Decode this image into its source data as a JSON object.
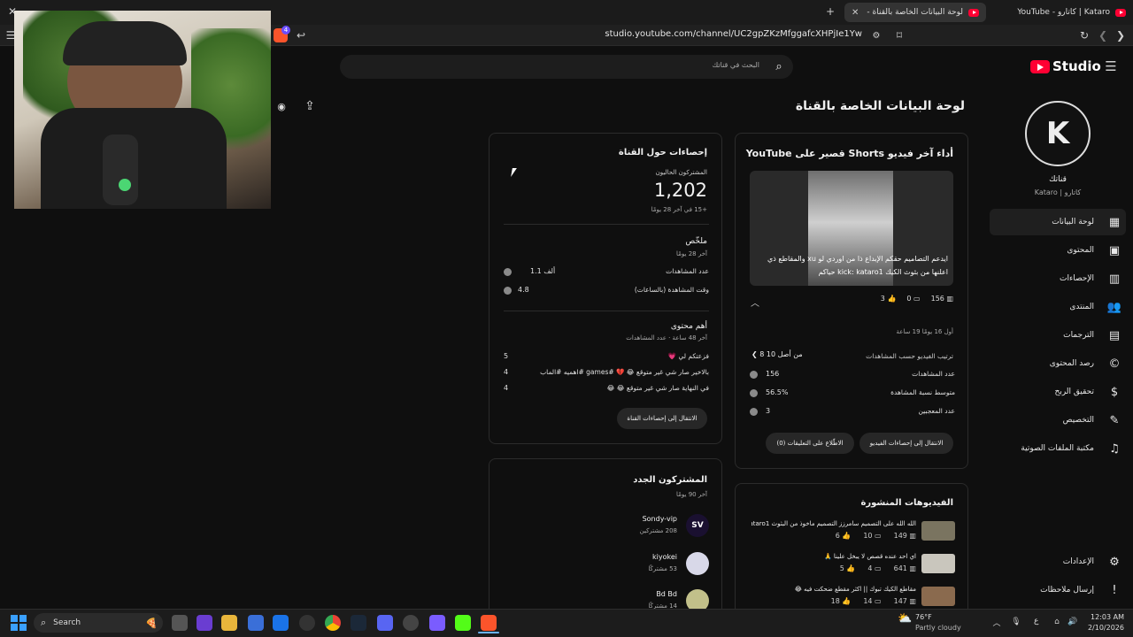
{
  "browser": {
    "tabs": [
      {
        "label": "Kataro | كاتارو - YouTube"
      },
      {
        "label": "لوحة البيانات الخاصة بالقناة - YouTube Studio"
      }
    ],
    "url": "studio.youtube.com/channel/UC2gpZKzMfggafcXHPjIe1Yw",
    "shields_count": "4"
  },
  "studio": {
    "logo_text": "Studio",
    "search_placeholder": "البحث في قناتك",
    "page_title": "لوحة البيانات الخاصة بالقناة",
    "channel": {
      "title": "قناتك",
      "name": "Kataro | كاتارو"
    }
  },
  "sidebar": {
    "items": [
      {
        "label": "لوحة البيانات",
        "icon": "dashboard-icon"
      },
      {
        "label": "المحتوى",
        "icon": "content-icon"
      },
      {
        "label": "الإحصاءات",
        "icon": "analytics-icon"
      },
      {
        "label": "المنتدى",
        "icon": "community-icon"
      },
      {
        "label": "الترجمات",
        "icon": "subtitles-icon"
      },
      {
        "label": "رصد المحتوى",
        "icon": "copyright-icon"
      },
      {
        "label": "تحقيق الربح",
        "icon": "earn-icon"
      },
      {
        "label": "التخصيص",
        "icon": "customization-icon"
      },
      {
        "label": "مكتبة الملفات الصوتية",
        "icon": "audio-library-icon"
      }
    ],
    "bottom": [
      {
        "label": "الإعدادات",
        "icon": "settings-icon"
      },
      {
        "label": "إرسال ملاحظات",
        "icon": "feedback-icon"
      }
    ]
  },
  "latest_short": {
    "title": "أداء آخر فيديو Shorts قصير على YouTube",
    "caption": "ايدعم التصاميم حقكم الإبداع ذا من اوردي لو xu والمقاطع ذي اعلنها من بثوث الكيك kick: kataro1 حياكم",
    "views": "156",
    "comments": "0",
    "likes": "3",
    "period": "أول 16 يومًا 19 ساعة",
    "rank_label": "ترتيب الفيديو حسب المشاهدات",
    "rank_value": "8 من أصل 10",
    "rows": [
      {
        "label": "عدد المشاهدات",
        "value": "156"
      },
      {
        "label": "متوسط نسبة المشاهدة",
        "value": "56.5%"
      },
      {
        "label": "عدد المعجبين",
        "value": "3"
      }
    ],
    "btn_analytics": "الانتقال إلى إحصاءات الفيديو",
    "btn_comments": "الاطّلاع على التعليقات (0)"
  },
  "channel_analytics": {
    "title": "إحصاءات حول القناة",
    "subs_label": "المشتركون الحاليون",
    "subs_value": "1,202",
    "subs_delta": "+15 في آخر 28 يومًا",
    "summary_title": "ملخّص",
    "summary_period": "آخر 28 يومًا",
    "summary_rows": [
      {
        "label": "عدد المشاهدات",
        "value": "1.1 ألف"
      },
      {
        "label": "وقت المشاهدة (بالساعات)",
        "value": "4.8"
      }
    ],
    "top_title": "أهم محتوى",
    "top_period": "آخر 48 ساعة · عدد المشاهدات",
    "top_rows": [
      {
        "label": "فزعتكم لي 💗",
        "value": "5"
      },
      {
        "label": "بالاخير صار شي غير متوقع 😂 💔 #games #اهميه #الماب",
        "value": "4"
      },
      {
        "label": "في النهاية صار شي غير متوقع 😂 😂",
        "value": "4"
      }
    ],
    "btn": "الانتقال إلى إحصاءات القناة"
  },
  "recent_subs": {
    "title": "المشتركون الجدد",
    "period": "آخر 90 يومًا",
    "items": [
      {
        "name": "Sondy-vip",
        "subs": "208 مشتركين",
        "avatar": "SV"
      },
      {
        "name": "kiyokei",
        "subs": "53 مشتركًا",
        "avatar": ""
      },
      {
        "name": "Bd Bd",
        "subs": "14 مشتركًا",
        "avatar": ""
      }
    ]
  },
  "published": {
    "title": "الفيديوهات المنشورة",
    "items": [
      {
        "title": "الله الله على التصميم سامرزز التصميم ماخوذ من البثوث ataro1...",
        "views": "149",
        "comments": "10",
        "likes": "6"
      },
      {
        "title": "اي احد عنده قصص لا يبخل علينا 🙏",
        "views": "641",
        "comments": "4",
        "likes": "5"
      },
      {
        "title": "مقاطع الكيك تبوك || اكثر مقطع ضحكت فيه 😂",
        "views": "147",
        "comments": "14",
        "likes": "18"
      }
    ]
  },
  "taskbar": {
    "search": "Search",
    "weather_temp": "76°F",
    "weather_desc": "Partly cloudy",
    "time": "12:03 AM",
    "date": "2/10/2026",
    "lang": "ع"
  },
  "colors": {
    "brand_red": "#ff0033",
    "accent_green": "#4bd673",
    "bg": "#0f0f0f"
  }
}
